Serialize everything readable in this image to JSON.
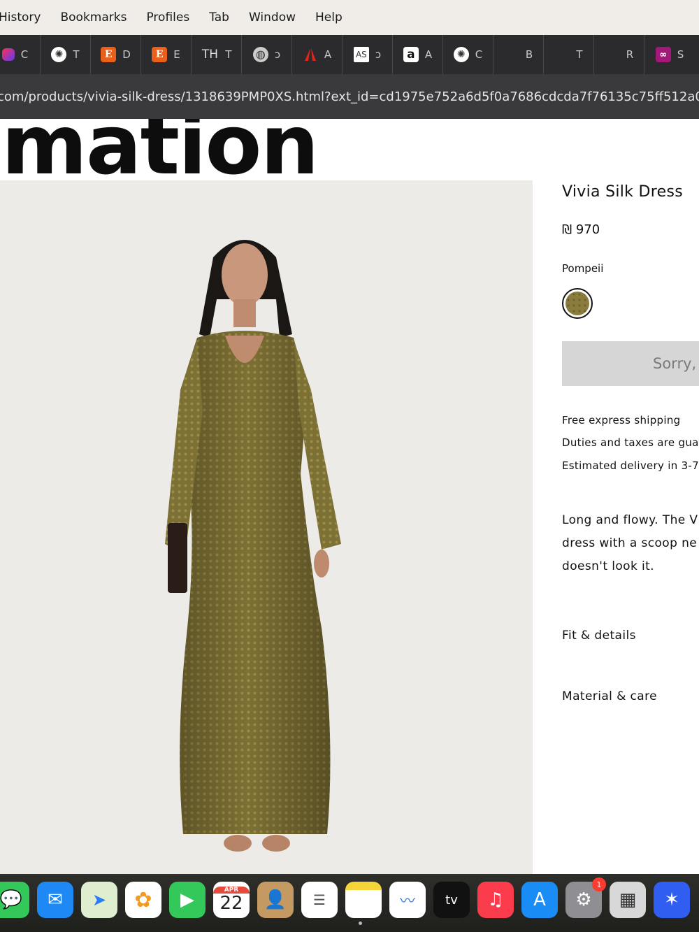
{
  "menubar": {
    "items": [
      "History",
      "Bookmarks",
      "Profiles",
      "Tab",
      "Window",
      "Help"
    ]
  },
  "tabs": [
    {
      "icon": "app-icon",
      "label": "C"
    },
    {
      "icon": "openai-icon",
      "label": "T"
    },
    {
      "icon": "etsy-icon",
      "label": "D",
      "glyph": "E"
    },
    {
      "icon": "etsy-icon",
      "label": "E",
      "glyph": "E"
    },
    {
      "icon": "th-icon",
      "label": "T",
      "glyph": "TH"
    },
    {
      "icon": "globe-icon",
      "label": "ↄ"
    },
    {
      "icon": "adobe-icon",
      "label": "A"
    },
    {
      "icon": "as-icon",
      "label": "ↄ",
      "glyph": "AS"
    },
    {
      "icon": "amazon-icon",
      "label": "A",
      "glyph": "a"
    },
    {
      "icon": "openai-icon",
      "label": "C"
    },
    {
      "icon": "blank-icon",
      "label": "B"
    },
    {
      "icon": "blank-icon",
      "label": "T"
    },
    {
      "icon": "blank-icon",
      "label": "R"
    },
    {
      "icon": "link-icon",
      "label": "S"
    }
  ],
  "address": {
    "url": "com/products/vivia-silk-dress/1318639PMP0XS.html?ext_id=cd1975e752a6d5f0a7686cdcda7f76135c75ff512a0"
  },
  "page": {
    "hero_text": "mation",
    "product": {
      "title": "Vivia Silk Dress",
      "price": "₪ 970",
      "color_name": "Pompeii",
      "button_label": "Sorry,",
      "shipping": [
        "Free express shipping",
        "Duties and taxes are guar",
        "Estimated delivery in 3-7"
      ],
      "description": [
        "Long and flowy. The V",
        "dress with a scoop ne",
        "doesn't look it."
      ],
      "accordions": [
        "Fit & details",
        "Material & care"
      ]
    }
  },
  "dock": {
    "calendar": {
      "month": "APR",
      "day": "22"
    },
    "settings_badge": "1",
    "apps": [
      "messages-icon",
      "mail-icon",
      "maps-icon",
      "photos-icon",
      "facetime-icon",
      "calendar-icon",
      "contacts-icon",
      "reminders-icon",
      "notes-icon",
      "freeform-icon",
      "appletv-icon",
      "music-icon",
      "appstore-icon",
      "settings-icon",
      "calculator-icon",
      "spark-icon"
    ]
  },
  "colors": {
    "menubar_bg": "#f0ede9",
    "tabstrip_bg": "#2b2b2d",
    "urlbar_bg": "#3a3a3c",
    "button_bg": "#d6d6d6",
    "dress": "#7a6d35"
  }
}
